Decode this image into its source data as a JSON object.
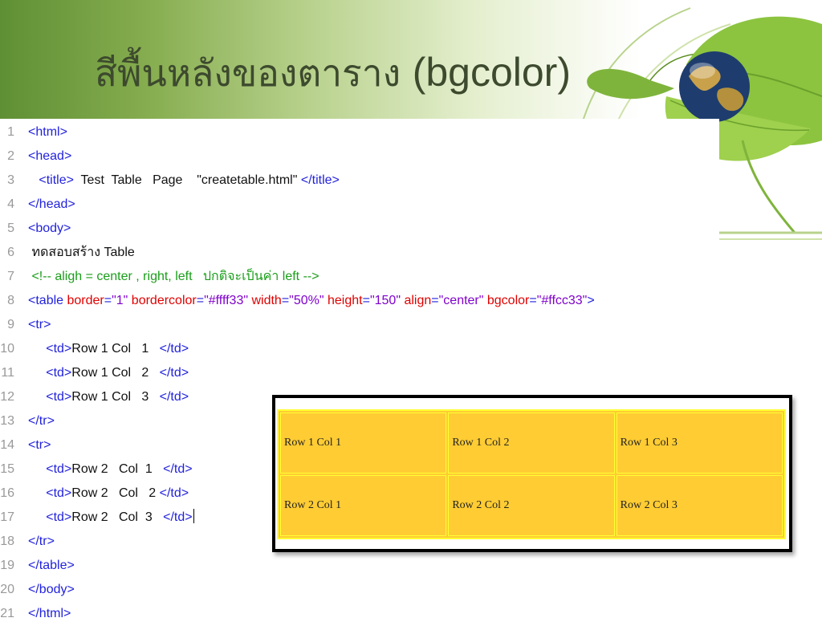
{
  "title": {
    "thai": "สีพื้นหลังของตาราง",
    "latin": "(bgcolor)"
  },
  "colors": {
    "title": "#3d4a2e",
    "tag": "#2222dd",
    "attribute": "#e00000",
    "value": "#7f00cc",
    "comment": "#1a9e1a",
    "table_bg": "#ffcc33",
    "table_border": "#ffff33"
  },
  "code": [
    {
      "n": "1",
      "parts": [
        {
          "t": "tag",
          "s": "<html>"
        }
      ]
    },
    {
      "n": "2",
      "parts": [
        {
          "t": "tag",
          "s": "<head>"
        }
      ]
    },
    {
      "n": "3",
      "parts": [
        {
          "t": "txt",
          "s": "   "
        },
        {
          "t": "tag",
          "s": "<title>"
        },
        {
          "t": "txt",
          "s": "  Test  Table   Page    \"createtable.html\" "
        },
        {
          "t": "tag",
          "s": "</title>"
        }
      ]
    },
    {
      "n": "4",
      "parts": [
        {
          "t": "tag",
          "s": "</head>"
        }
      ]
    },
    {
      "n": "5",
      "parts": [
        {
          "t": "tag",
          "s": "<body>"
        }
      ]
    },
    {
      "n": "6",
      "parts": [
        {
          "t": "txt",
          "s": " ทดสอบสร้าง Table"
        }
      ]
    },
    {
      "n": "7",
      "parts": [
        {
          "t": "cmt",
          "s": " <!-- aligh = center , right, left   ปกติจะเป็นค่า left -->"
        }
      ]
    },
    {
      "n": "8",
      "parts": [
        {
          "t": "tag",
          "s": "<table "
        },
        {
          "t": "attr",
          "s": "border"
        },
        {
          "t": "tag",
          "s": "="
        },
        {
          "t": "val",
          "s": "\"1\""
        },
        {
          "t": "attr",
          "s": " bordercolor"
        },
        {
          "t": "tag",
          "s": "="
        },
        {
          "t": "val",
          "s": "\"#ffff33\""
        },
        {
          "t": "attr",
          "s": " width"
        },
        {
          "t": "tag",
          "s": "="
        },
        {
          "t": "val",
          "s": "\"50%\""
        },
        {
          "t": "attr",
          "s": " height"
        },
        {
          "t": "tag",
          "s": "="
        },
        {
          "t": "val",
          "s": "\"150\""
        },
        {
          "t": "attr",
          "s": " align"
        },
        {
          "t": "tag",
          "s": "="
        },
        {
          "t": "val",
          "s": "\"center\""
        },
        {
          "t": "attr",
          "s": " bgcolor"
        },
        {
          "t": "tag",
          "s": "="
        },
        {
          "t": "val",
          "s": "\"#ffcc33\""
        },
        {
          "t": "tag",
          "s": ">"
        }
      ]
    },
    {
      "n": "9",
      "parts": [
        {
          "t": "tag",
          "s": "<tr>"
        }
      ]
    },
    {
      "n": "10",
      "parts": [
        {
          "t": "txt",
          "s": "     "
        },
        {
          "t": "tag",
          "s": "<td>"
        },
        {
          "t": "txt",
          "s": "Row 1 Col   1   "
        },
        {
          "t": "tag",
          "s": "</td>"
        }
      ]
    },
    {
      "n": "11",
      "parts": [
        {
          "t": "txt",
          "s": "     "
        },
        {
          "t": "tag",
          "s": "<td>"
        },
        {
          "t": "txt",
          "s": "Row 1 Col   2   "
        },
        {
          "t": "tag",
          "s": "</td>"
        }
      ]
    },
    {
      "n": "12",
      "parts": [
        {
          "t": "txt",
          "s": "     "
        },
        {
          "t": "tag",
          "s": "<td>"
        },
        {
          "t": "txt",
          "s": "Row 1 Col   3   "
        },
        {
          "t": "tag",
          "s": "</td>"
        }
      ]
    },
    {
      "n": "13",
      "parts": [
        {
          "t": "tag",
          "s": "</tr>"
        }
      ]
    },
    {
      "n": "14",
      "parts": [
        {
          "t": "tag",
          "s": "<tr>"
        }
      ]
    },
    {
      "n": "15",
      "parts": [
        {
          "t": "txt",
          "s": "     "
        },
        {
          "t": "tag",
          "s": "<td>"
        },
        {
          "t": "txt",
          "s": "Row 2   Col  1   "
        },
        {
          "t": "tag",
          "s": "</td>"
        }
      ]
    },
    {
      "n": "16",
      "parts": [
        {
          "t": "txt",
          "s": "     "
        },
        {
          "t": "tag",
          "s": "<td>"
        },
        {
          "t": "txt",
          "s": "Row 2   Col   2 "
        },
        {
          "t": "tag",
          "s": "</td>"
        }
      ]
    },
    {
      "n": "17",
      "parts": [
        {
          "t": "txt",
          "s": "     "
        },
        {
          "t": "tag",
          "s": "<td>"
        },
        {
          "t": "txt",
          "s": "Row 2   Col  3   "
        },
        {
          "t": "tag",
          "s": "</td>"
        }
      ],
      "caret": true
    },
    {
      "n": "18",
      "parts": [
        {
          "t": "tag",
          "s": "</tr>"
        }
      ]
    },
    {
      "n": "19",
      "parts": [
        {
          "t": "tag",
          "s": "</table>"
        }
      ]
    },
    {
      "n": "20",
      "parts": [
        {
          "t": "tag",
          "s": "</body>"
        }
      ]
    },
    {
      "n": "21",
      "parts": [
        {
          "t": "tag",
          "s": "</html>"
        }
      ]
    }
  ],
  "preview_table": {
    "rows": [
      [
        "Row 1 Col 1",
        "Row 1 Col 2",
        "Row 1 Col 3"
      ],
      [
        "Row 2 Col 1",
        "Row 2 Col 2",
        "Row 2 Col 3"
      ]
    ]
  },
  "decoration": {
    "icon": "leaf-globe-icon"
  }
}
